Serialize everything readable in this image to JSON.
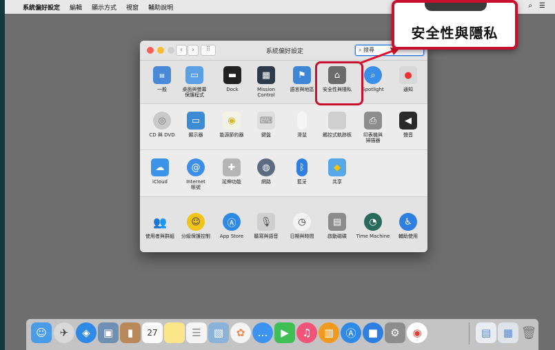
{
  "menubar": {
    "apple": "",
    "items": [
      "系統偏好設定",
      "編輯",
      "顯示方式",
      "視窗",
      "輔助說明"
    ],
    "right_icons": [
      "search-icon",
      "list-icon"
    ]
  },
  "window": {
    "title": "系統偏好設定",
    "search_value": "搜尋"
  },
  "prefs": {
    "row1": [
      {
        "label": "一般"
      },
      {
        "label": "桌面與螢幕\n保護程式"
      },
      {
        "label": "Dock"
      },
      {
        "label": "Mission\nControl"
      },
      {
        "label": "語言與地區"
      },
      {
        "label": "安全性與隱私"
      },
      {
        "label": "Spotlight"
      },
      {
        "label": "通知"
      }
    ],
    "row2": [
      {
        "label": "CD 與 DVD"
      },
      {
        "label": "顯示器"
      },
      {
        "label": "能源節約器"
      },
      {
        "label": "鍵盤"
      },
      {
        "label": "滑鼠"
      },
      {
        "label": "觸控式軌跡板"
      },
      {
        "label": "印表機與\n掃描器"
      },
      {
        "label": "聲音"
      }
    ],
    "row3": [
      {
        "label": "iCloud"
      },
      {
        "label": "Internet\n帳號"
      },
      {
        "label": "延伸功能"
      },
      {
        "label": "網路"
      },
      {
        "label": "藍牙"
      },
      {
        "label": "共享"
      }
    ],
    "row4": [
      {
        "label": "使用者與群組"
      },
      {
        "label": "分級保護控制"
      },
      {
        "label": "App Store"
      },
      {
        "label": "聽寫與語音"
      },
      {
        "label": "日期與時間"
      },
      {
        "label": "啟動磁碟"
      },
      {
        "label": "Time Machine"
      },
      {
        "label": "輔助使用"
      }
    ]
  },
  "callout": {
    "text": "安全性與隱私"
  },
  "dock": {
    "calendar_day": "27",
    "colors": {
      "accent": "#c8102e"
    }
  }
}
